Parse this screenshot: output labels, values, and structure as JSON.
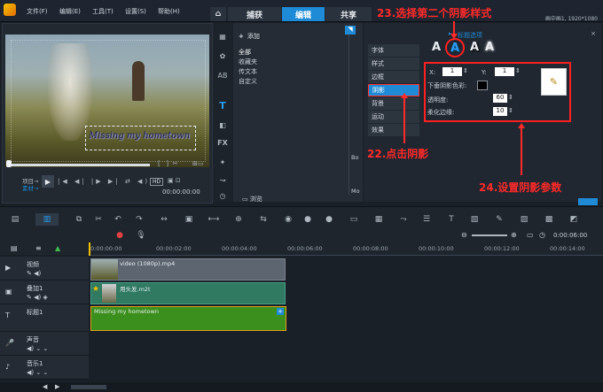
{
  "menu": {
    "file": "文件(F)",
    "edit": "编辑(E)",
    "tools": "工具(T)",
    "settings": "设置(S)",
    "help": "帮助(H)"
  },
  "tabs": {
    "home": "⌂",
    "capture": "捕获",
    "edit": "编辑",
    "share": "共享"
  },
  "window_info": "画中画1, 1920*1080",
  "annotations": {
    "a23": "23.选择第二个阴影样式",
    "a22": "22.点击阴影",
    "a24": "24.设置阴影参数"
  },
  "preview": {
    "overlay_text": "Missing my hometown",
    "mode_project": "项目→",
    "mode_clip": "素材→",
    "hd_badge": "HD",
    "timecode": "00:00:00:00"
  },
  "library": {
    "add_label": "添加",
    "folders": [
      "全部",
      "收藏夹",
      "传文本",
      "自定义"
    ],
    "browse_label": "浏览",
    "partial_labels": [
      "Bo",
      "Mo"
    ]
  },
  "options": {
    "title": "标题选项",
    "tabs": [
      "字体",
      "样式",
      "边框",
      "阴影",
      "背景",
      "运动",
      "效果"
    ],
    "active_tab_index": 3,
    "x_label": "X:",
    "x_value": "1",
    "y_label": "Y:",
    "y_value": "1",
    "shadow_color_label": "下垂阴影色彩:",
    "opacity_label": "透明度:",
    "opacity_value": "60",
    "softness_label": "柔化边缘:",
    "softness_value": "10",
    "style_letter": "A"
  },
  "timeline": {
    "ruler": [
      "0:00:00:00",
      "00:00:02:00",
      "00:00:04:00",
      "00:00:06:00",
      "00:00:08:00",
      "00:00:10:00",
      "00:00:12:00",
      "00:00:14:00"
    ],
    "zoom_time": "0:00:06:00",
    "tracks": [
      {
        "name": "视频"
      },
      {
        "name": "叠加1"
      },
      {
        "name": "标题1"
      },
      {
        "name": "声音"
      },
      {
        "name": "音乐1"
      }
    ],
    "clips": {
      "video": "video (1080p).mp4",
      "overlay": "用头发.m2t",
      "title": "Missing my hometown"
    }
  },
  "colors": {
    "accent": "#1f8bd6",
    "annotation": "#ff2a2a",
    "title_clip": "#3b8f1c",
    "overlay_clip": "#2f7a61",
    "video_clip": "#5c6570"
  }
}
